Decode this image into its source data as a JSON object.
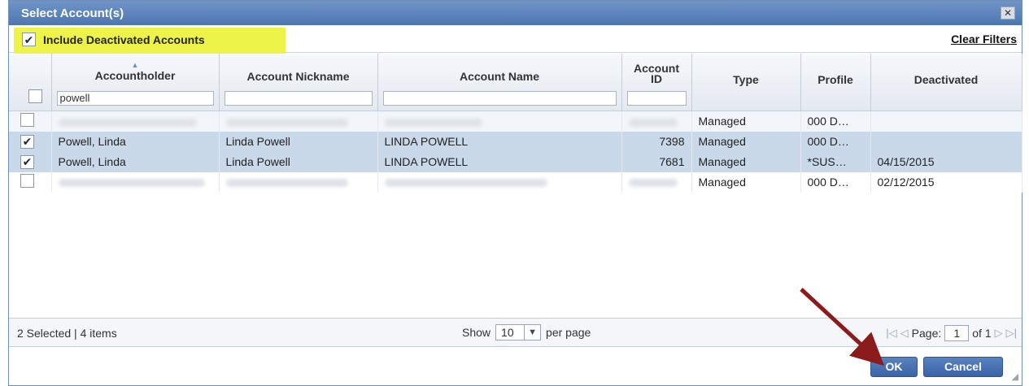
{
  "dialog": {
    "title": "Select Account(s)",
    "close_icon": "close-icon",
    "include_deactivated_label": "Include Deactivated Accounts",
    "include_deactivated_checked": true,
    "clear_filters_label": "Clear Filters"
  },
  "columns": {
    "accountholder": "Accountholder",
    "nickname": "Account Nickname",
    "name": "Account Name",
    "account_id": "Account ID",
    "type": "Type",
    "profile": "Profile",
    "deactivated": "Deactivated"
  },
  "filters": {
    "accountholder": "powell",
    "nickname": "",
    "name": "",
    "account_id": ""
  },
  "rows": [
    {
      "checked": false,
      "accountholder": "",
      "nickname": "",
      "name": "",
      "account_id": "",
      "type": "Managed",
      "profile": "000 D…",
      "deactivated": ""
    },
    {
      "checked": true,
      "accountholder": "Powell, Linda",
      "nickname": "Linda Powell",
      "name": "LINDA POWELL",
      "account_id": "7398",
      "type": "Managed",
      "profile": "000 D…",
      "deactivated": ""
    },
    {
      "checked": true,
      "accountholder": "Powell, Linda",
      "nickname": "Linda Powell",
      "name": "LINDA POWELL",
      "account_id": "7681",
      "type": "Managed",
      "profile": "*SUS…",
      "deactivated": "04/15/2015"
    },
    {
      "checked": false,
      "accountholder": "",
      "nickname": "",
      "name": "",
      "account_id": "",
      "type": "Managed",
      "profile": "000 D…",
      "deactivated": "02/12/2015"
    }
  ],
  "footer": {
    "selection_summary": "2 Selected | 4 items",
    "show_label": "Show",
    "per_page_value": "10",
    "per_page_label": "per page",
    "page_label": "Page:",
    "page_value": "1",
    "of_label": "of 1"
  },
  "buttons": {
    "ok": "OK",
    "cancel": "Cancel"
  },
  "colors": {
    "titlebar": "#5a82bc",
    "highlight": "#eef34a",
    "selected_row": "#c9d9e9",
    "button": "#4a72b4",
    "annotation_arrow": "#8b1a1a"
  }
}
